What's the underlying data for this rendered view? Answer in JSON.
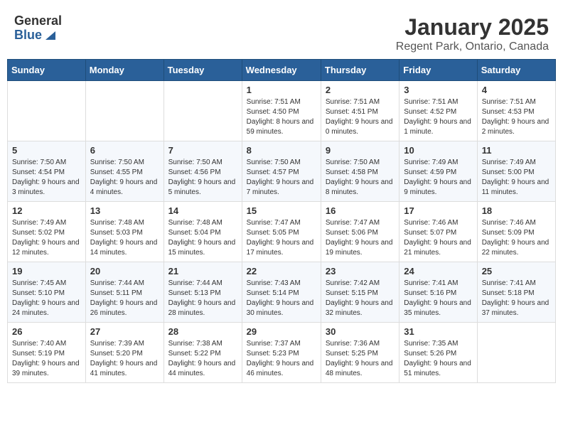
{
  "header": {
    "logo_general": "General",
    "logo_blue": "Blue",
    "month": "January 2025",
    "location": "Regent Park, Ontario, Canada"
  },
  "weekdays": [
    "Sunday",
    "Monday",
    "Tuesday",
    "Wednesday",
    "Thursday",
    "Friday",
    "Saturday"
  ],
  "weeks": [
    [
      {
        "day": "",
        "info": ""
      },
      {
        "day": "",
        "info": ""
      },
      {
        "day": "",
        "info": ""
      },
      {
        "day": "1",
        "info": "Sunrise: 7:51 AM\nSunset: 4:50 PM\nDaylight: 8 hours and 59 minutes."
      },
      {
        "day": "2",
        "info": "Sunrise: 7:51 AM\nSunset: 4:51 PM\nDaylight: 9 hours and 0 minutes."
      },
      {
        "day": "3",
        "info": "Sunrise: 7:51 AM\nSunset: 4:52 PM\nDaylight: 9 hours and 1 minute."
      },
      {
        "day": "4",
        "info": "Sunrise: 7:51 AM\nSunset: 4:53 PM\nDaylight: 9 hours and 2 minutes."
      }
    ],
    [
      {
        "day": "5",
        "info": "Sunrise: 7:50 AM\nSunset: 4:54 PM\nDaylight: 9 hours and 3 minutes."
      },
      {
        "day": "6",
        "info": "Sunrise: 7:50 AM\nSunset: 4:55 PM\nDaylight: 9 hours and 4 minutes."
      },
      {
        "day": "7",
        "info": "Sunrise: 7:50 AM\nSunset: 4:56 PM\nDaylight: 9 hours and 5 minutes."
      },
      {
        "day": "8",
        "info": "Sunrise: 7:50 AM\nSunset: 4:57 PM\nDaylight: 9 hours and 7 minutes."
      },
      {
        "day": "9",
        "info": "Sunrise: 7:50 AM\nSunset: 4:58 PM\nDaylight: 9 hours and 8 minutes."
      },
      {
        "day": "10",
        "info": "Sunrise: 7:49 AM\nSunset: 4:59 PM\nDaylight: 9 hours and 9 minutes."
      },
      {
        "day": "11",
        "info": "Sunrise: 7:49 AM\nSunset: 5:00 PM\nDaylight: 9 hours and 11 minutes."
      }
    ],
    [
      {
        "day": "12",
        "info": "Sunrise: 7:49 AM\nSunset: 5:02 PM\nDaylight: 9 hours and 12 minutes."
      },
      {
        "day": "13",
        "info": "Sunrise: 7:48 AM\nSunset: 5:03 PM\nDaylight: 9 hours and 14 minutes."
      },
      {
        "day": "14",
        "info": "Sunrise: 7:48 AM\nSunset: 5:04 PM\nDaylight: 9 hours and 15 minutes."
      },
      {
        "day": "15",
        "info": "Sunrise: 7:47 AM\nSunset: 5:05 PM\nDaylight: 9 hours and 17 minutes."
      },
      {
        "day": "16",
        "info": "Sunrise: 7:47 AM\nSunset: 5:06 PM\nDaylight: 9 hours and 19 minutes."
      },
      {
        "day": "17",
        "info": "Sunrise: 7:46 AM\nSunset: 5:07 PM\nDaylight: 9 hours and 21 minutes."
      },
      {
        "day": "18",
        "info": "Sunrise: 7:46 AM\nSunset: 5:09 PM\nDaylight: 9 hours and 22 minutes."
      }
    ],
    [
      {
        "day": "19",
        "info": "Sunrise: 7:45 AM\nSunset: 5:10 PM\nDaylight: 9 hours and 24 minutes."
      },
      {
        "day": "20",
        "info": "Sunrise: 7:44 AM\nSunset: 5:11 PM\nDaylight: 9 hours and 26 minutes."
      },
      {
        "day": "21",
        "info": "Sunrise: 7:44 AM\nSunset: 5:13 PM\nDaylight: 9 hours and 28 minutes."
      },
      {
        "day": "22",
        "info": "Sunrise: 7:43 AM\nSunset: 5:14 PM\nDaylight: 9 hours and 30 minutes."
      },
      {
        "day": "23",
        "info": "Sunrise: 7:42 AM\nSunset: 5:15 PM\nDaylight: 9 hours and 32 minutes."
      },
      {
        "day": "24",
        "info": "Sunrise: 7:41 AM\nSunset: 5:16 PM\nDaylight: 9 hours and 35 minutes."
      },
      {
        "day": "25",
        "info": "Sunrise: 7:41 AM\nSunset: 5:18 PM\nDaylight: 9 hours and 37 minutes."
      }
    ],
    [
      {
        "day": "26",
        "info": "Sunrise: 7:40 AM\nSunset: 5:19 PM\nDaylight: 9 hours and 39 minutes."
      },
      {
        "day": "27",
        "info": "Sunrise: 7:39 AM\nSunset: 5:20 PM\nDaylight: 9 hours and 41 minutes."
      },
      {
        "day": "28",
        "info": "Sunrise: 7:38 AM\nSunset: 5:22 PM\nDaylight: 9 hours and 44 minutes."
      },
      {
        "day": "29",
        "info": "Sunrise: 7:37 AM\nSunset: 5:23 PM\nDaylight: 9 hours and 46 minutes."
      },
      {
        "day": "30",
        "info": "Sunrise: 7:36 AM\nSunset: 5:25 PM\nDaylight: 9 hours and 48 minutes."
      },
      {
        "day": "31",
        "info": "Sunrise: 7:35 AM\nSunset: 5:26 PM\nDaylight: 9 hours and 51 minutes."
      },
      {
        "day": "",
        "info": ""
      }
    ]
  ]
}
